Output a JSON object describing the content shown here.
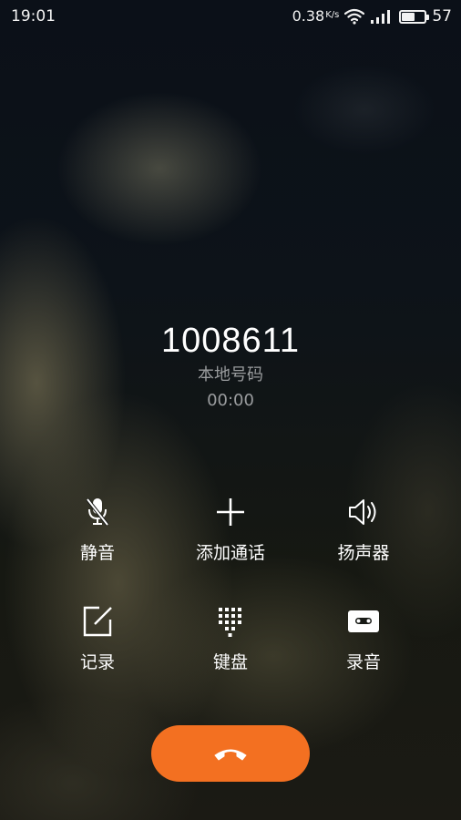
{
  "status_bar": {
    "time": "19:01",
    "net_speed": "0.38",
    "net_speed_unit": "K/s",
    "battery": "57",
    "battery_level_percent": 57,
    "icons": [
      "wifi-icon",
      "signal-icon",
      "battery-icon"
    ]
  },
  "call": {
    "number": "1008611",
    "location": "本地号码",
    "duration": "00:00"
  },
  "actions": {
    "mute": {
      "label": "静音",
      "icon": "mic-muted-icon"
    },
    "add_call": {
      "label": "添加通话",
      "icon": "plus-icon"
    },
    "speaker": {
      "label": "扬声器",
      "icon": "speaker-icon"
    },
    "notes": {
      "label": "记录",
      "icon": "note-edit-icon"
    },
    "keypad": {
      "label": "键盘",
      "icon": "keypad-icon"
    },
    "record": {
      "label": "录音",
      "icon": "cassette-icon"
    }
  },
  "end_call": {
    "icon": "hang-up-icon"
  },
  "colors": {
    "end_call": "#f37021",
    "secondary_text": "#9a9c9e"
  }
}
